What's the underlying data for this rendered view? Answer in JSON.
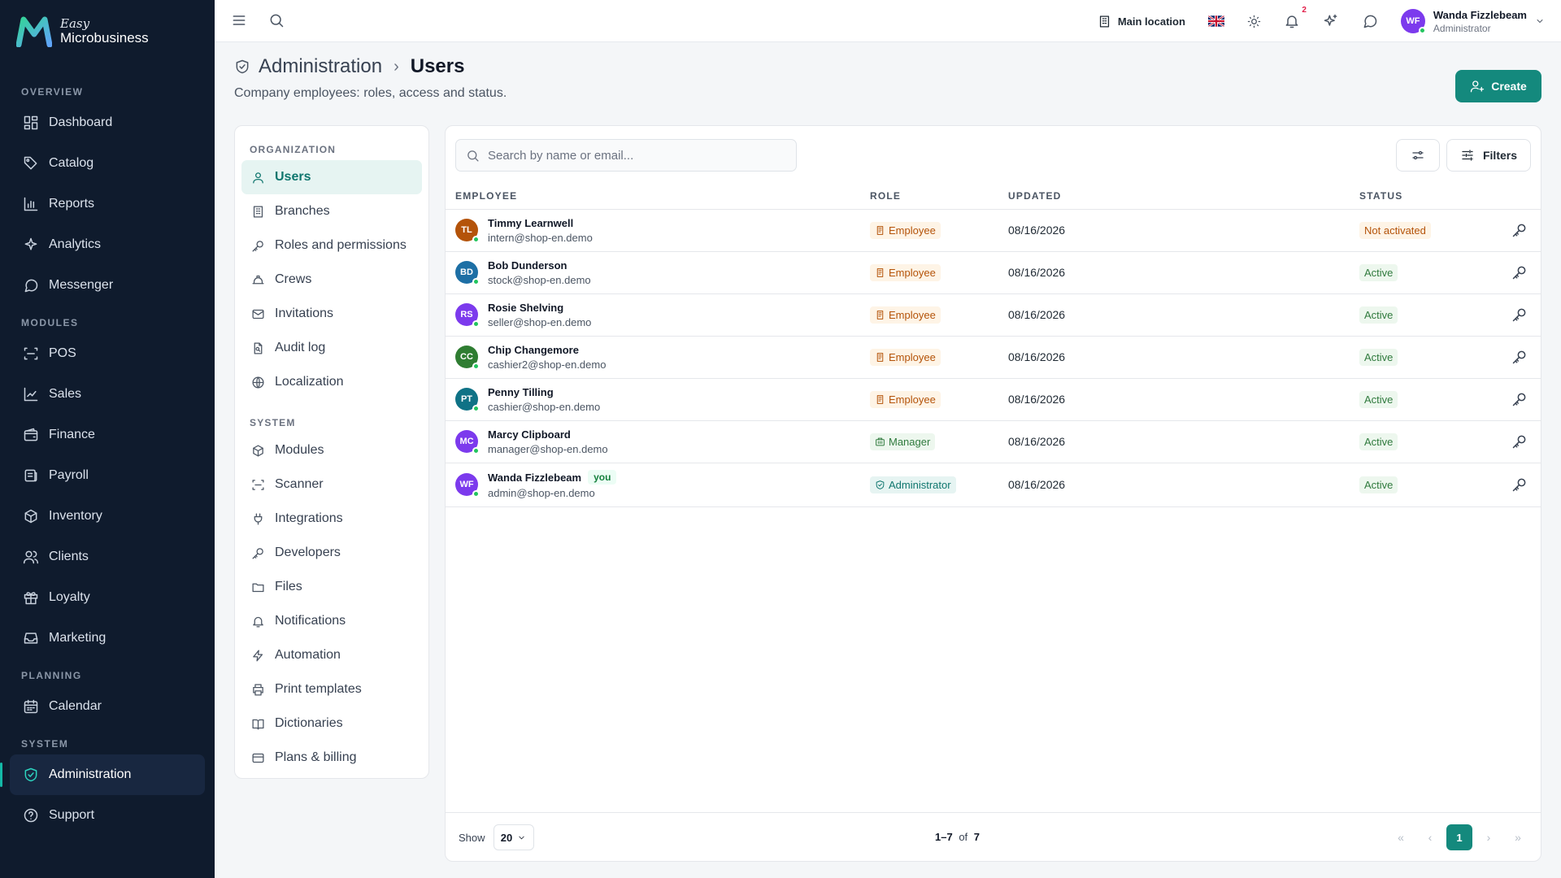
{
  "brand": {
    "line1": "Easy",
    "line2": "Microbusiness"
  },
  "nav": {
    "overview_label": "OVERVIEW",
    "overview": [
      {
        "label": "Dashboard",
        "icon": "dashboard-icon"
      },
      {
        "label": "Catalog",
        "icon": "catalog-icon"
      },
      {
        "label": "Reports",
        "icon": "reports-icon"
      },
      {
        "label": "Analytics",
        "icon": "analytics-icon"
      },
      {
        "label": "Messenger",
        "icon": "messenger-icon"
      }
    ],
    "modules_label": "MODULES",
    "modules": [
      {
        "label": "POS",
        "icon": "pos-icon"
      },
      {
        "label": "Sales",
        "icon": "sales-icon"
      },
      {
        "label": "Finance",
        "icon": "finance-icon"
      },
      {
        "label": "Payroll",
        "icon": "payroll-icon"
      },
      {
        "label": "Inventory",
        "icon": "inventory-icon"
      },
      {
        "label": "Clients",
        "icon": "clients-icon"
      },
      {
        "label": "Loyalty",
        "icon": "loyalty-icon"
      },
      {
        "label": "Marketing",
        "icon": "marketing-icon"
      }
    ],
    "planning_label": "PLANNING",
    "planning": [
      {
        "label": "Calendar",
        "icon": "calendar-icon"
      }
    ],
    "system_label": "SYSTEM",
    "system": [
      {
        "label": "Administration",
        "icon": "shield-icon",
        "active": true
      },
      {
        "label": "Support",
        "icon": "help-icon"
      }
    ]
  },
  "topbar": {
    "location": "Main location",
    "notifications_count": "2",
    "user_name": "Wanda Fizzlebeam",
    "user_role": "Administrator",
    "user_initials": "WF"
  },
  "header": {
    "parent": "Administration",
    "separator": "›",
    "current": "Users",
    "subtitle": "Company employees: roles, access and status.",
    "create_label": "Create"
  },
  "subnav": {
    "org_label": "ORGANIZATION",
    "org": [
      "Users",
      "Branches",
      "Roles and permissions",
      "Crews",
      "Invitations",
      "Audit log",
      "Localization"
    ],
    "system_label": "SYSTEM",
    "system": [
      "Modules",
      "Scanner",
      "Integrations",
      "Developers",
      "Files",
      "Notifications",
      "Automation",
      "Print templates",
      "Dictionaries",
      "Plans & billing"
    ]
  },
  "toolbar": {
    "search_placeholder": "Search by name or email...",
    "filters_label": "Filters"
  },
  "table": {
    "columns": [
      "EMPLOYEE",
      "ROLE",
      "UPDATED",
      "STATUS"
    ],
    "rows": [
      {
        "initials": "TL",
        "color": "#b45309",
        "name": "Timmy Learnwell",
        "email": "intern@shop-en.demo",
        "role": "Employee",
        "updated": "08/16/2026",
        "status": "Not activated"
      },
      {
        "initials": "BD",
        "color": "#1d6fa5",
        "name": "Bob Dunderson",
        "email": "stock@shop-en.demo",
        "role": "Employee",
        "updated": "08/16/2026",
        "status": "Active"
      },
      {
        "initials": "RS",
        "color": "#7c3aed",
        "name": "Rosie Shelving",
        "email": "seller@shop-en.demo",
        "role": "Employee",
        "updated": "08/16/2026",
        "status": "Active"
      },
      {
        "initials": "CC",
        "color": "#2f7d32",
        "name": "Chip Changemore",
        "email": "cashier2@shop-en.demo",
        "role": "Employee",
        "updated": "08/16/2026",
        "status": "Active"
      },
      {
        "initials": "PT",
        "color": "#0f7286",
        "name": "Penny Tilling",
        "email": "cashier@shop-en.demo",
        "role": "Employee",
        "updated": "08/16/2026",
        "status": "Active"
      },
      {
        "initials": "MC",
        "color": "#7c3aed",
        "name": "Marcy Clipboard",
        "email": "manager@shop-en.demo",
        "role": "Manager",
        "updated": "08/16/2026",
        "status": "Active"
      },
      {
        "initials": "WF",
        "color": "#7c3aed",
        "name": "Wanda Fizzlebeam",
        "email": "admin@shop-en.demo",
        "role": "Administrator",
        "updated": "08/16/2026",
        "status": "Active",
        "you": "you"
      }
    ]
  },
  "footer": {
    "show_label": "Show",
    "per_page": "20",
    "range": "1–7",
    "of_label": "of",
    "total": "7",
    "page": "1"
  },
  "colors": {
    "accent": "#14897d",
    "sidebar": "#0f1b2d"
  }
}
